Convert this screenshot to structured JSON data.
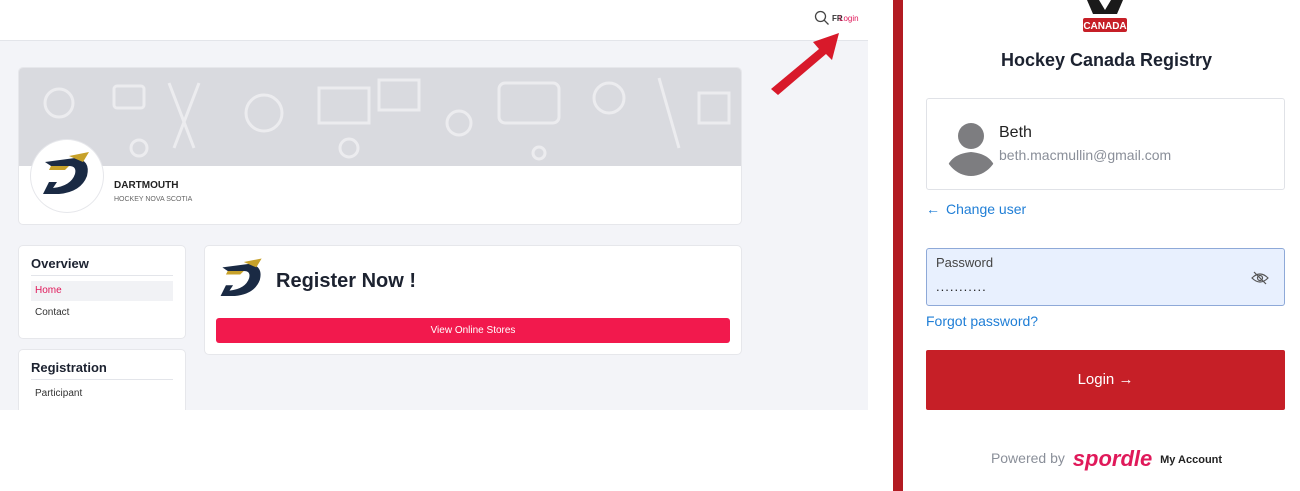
{
  "site": {
    "topbar": {
      "lang": "FR",
      "login": "Login"
    },
    "club": {
      "name": "DARTMOUTH",
      "association": "HOCKEY NOVA SCOTIA"
    },
    "overview": {
      "title": "Overview",
      "items": [
        "Home",
        "Contact"
      ],
      "active_index": 0
    },
    "registration": {
      "title": "Registration",
      "items": [
        "Participant"
      ]
    },
    "register": {
      "title": "Register Now !",
      "button": "View Online Stores"
    }
  },
  "login": {
    "brand": "CANADA",
    "title": "Hockey Canada Registry",
    "user": {
      "name": "Beth",
      "email": "beth.macmullin@gmail.com"
    },
    "change_user": "Change user",
    "password": {
      "label": "Password",
      "value": "..........."
    },
    "forgot": "Forgot password?",
    "button": "Login",
    "powered_by": "Powered by",
    "spordle": "spordle",
    "my_account": "My Account"
  },
  "colors": {
    "accent_pink": "#e0195a",
    "button_pink": "#f2194d",
    "login_red": "#c61f27",
    "link_blue": "#1f7ed6"
  },
  "icons": {
    "search": "search-icon",
    "arrow_left": "arrow-left-icon",
    "arrow_right": "arrow-right-icon",
    "eye_off": "eye-off-icon",
    "avatar": "user-avatar-icon"
  }
}
